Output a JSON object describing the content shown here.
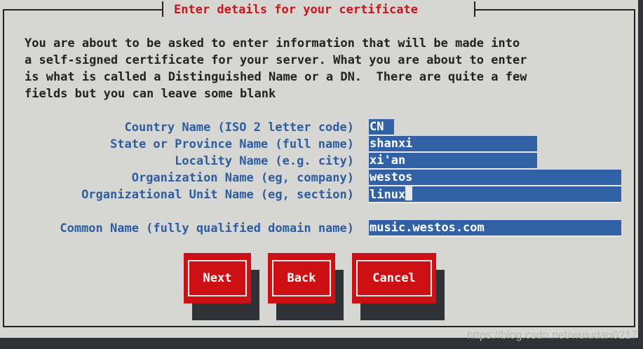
{
  "dialog": {
    "title": "Enter details for your certificate",
    "intro_lines": [
      "You are about to be asked to enter information that will be made into",
      "a self-signed certificate for your server. What you are about to enter",
      "is what is called a Distinguished Name or a DN.  There are quite a few",
      "fields but you can leave some blank"
    ]
  },
  "fields": {
    "country": {
      "label": "Country Name (ISO 2 letter code)",
      "value": "CN"
    },
    "state": {
      "label": "State or Province Name (full name)",
      "value": "shanxi"
    },
    "locality": {
      "label": "Locality Name (e.g. city)",
      "value": "xi'an"
    },
    "organization": {
      "label": "Organization Name (eg, company)",
      "value": "westos"
    },
    "org_unit": {
      "label": "Organizational Unit Name (eg, section)",
      "value": "linux"
    },
    "common_name": {
      "label": "Common Name (fully qualified domain name)",
      "value": "music.westos.com"
    }
  },
  "buttons": {
    "next": "Next",
    "back": "Back",
    "cancel": "Cancel"
  },
  "colors": {
    "dialog_bg": "#d6d6d2",
    "title_red": "#c8141a",
    "label_blue": "#2d5da0",
    "field_blue": "#3261a6",
    "button_red": "#cc1014",
    "screen_bg": "#2f3237"
  },
  "watermark": "https://blog.csdn.net/wuludan0217"
}
